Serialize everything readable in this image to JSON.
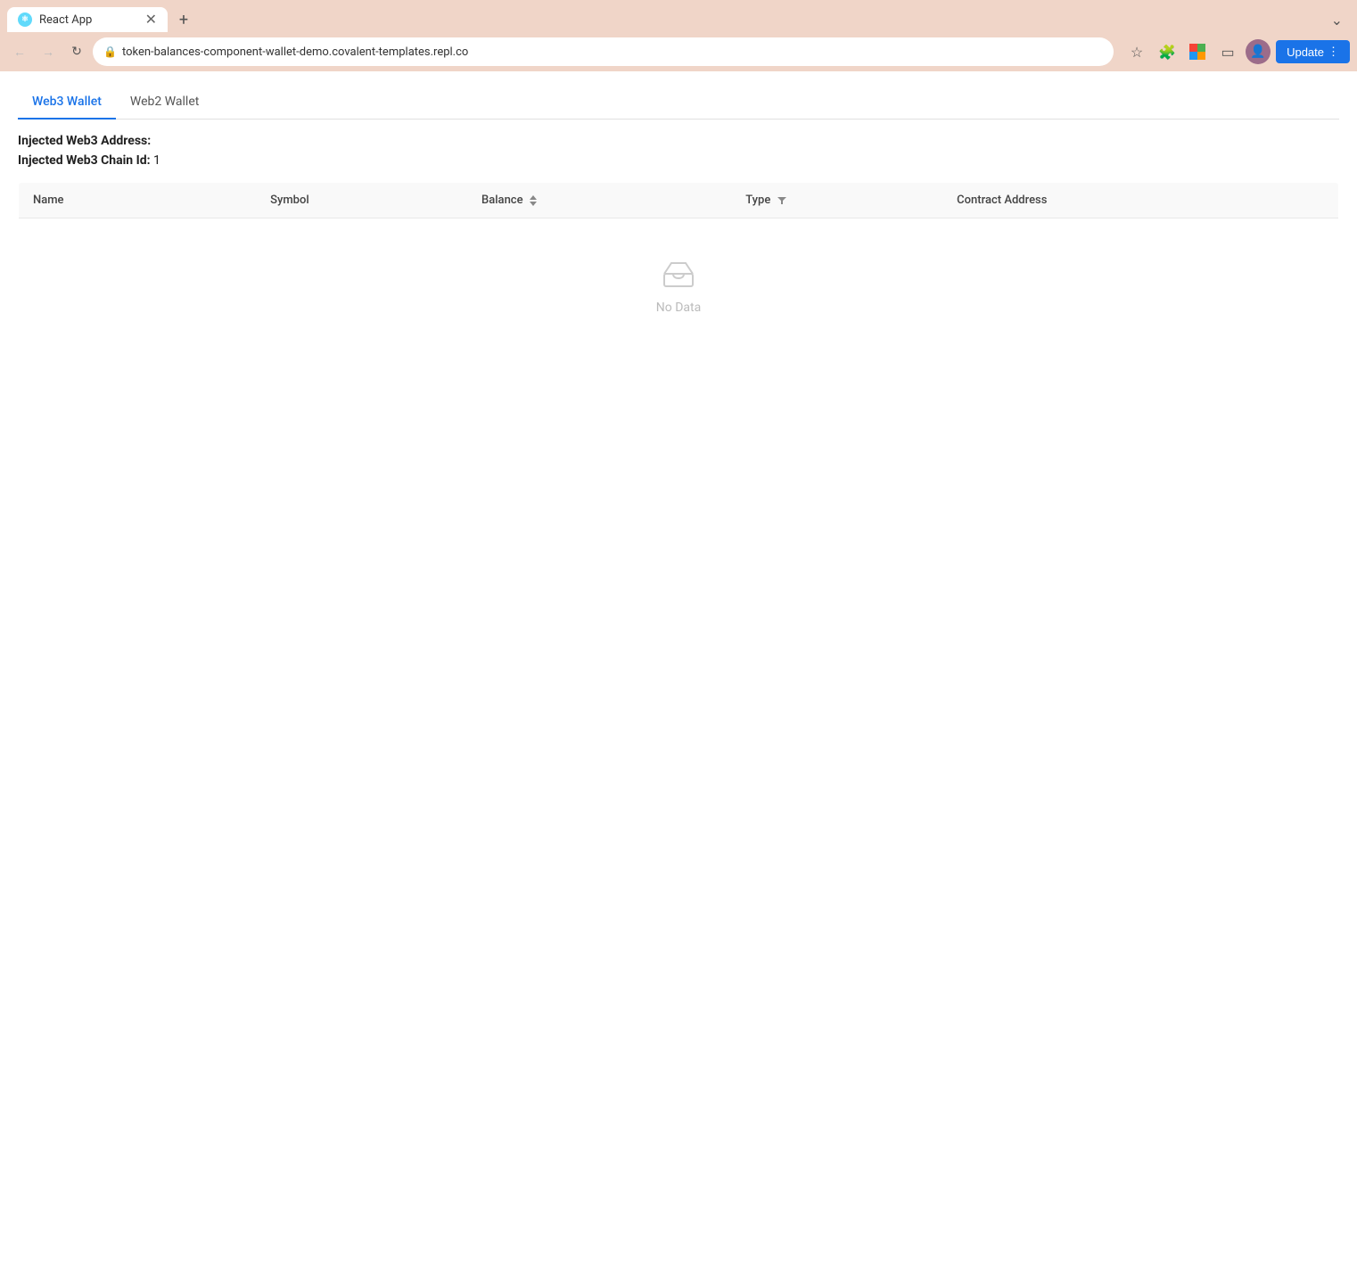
{
  "browser": {
    "tab_title": "React App",
    "tab_favicon": "R",
    "address": "token-balances-component-wallet-demo.covalent-templates.repl.co",
    "update_button": "Update"
  },
  "app_tabs": [
    {
      "label": "Web3 Wallet",
      "active": true
    },
    {
      "label": "Web2 Wallet",
      "active": false
    }
  ],
  "wallet_info": {
    "address_label": "Injected Web3 Address:",
    "address_value": "",
    "chain_label": "Injected Web3 Chain Id:",
    "chain_value": "1"
  },
  "table": {
    "columns": [
      {
        "key": "name",
        "label": "Name",
        "sortable": false,
        "filterable": false
      },
      {
        "key": "symbol",
        "label": "Symbol",
        "sortable": false,
        "filterable": false
      },
      {
        "key": "balance",
        "label": "Balance",
        "sortable": true,
        "filterable": false
      },
      {
        "key": "type",
        "label": "Type",
        "sortable": false,
        "filterable": true
      },
      {
        "key": "contract",
        "label": "Contract Address",
        "sortable": false,
        "filterable": false
      }
    ],
    "rows": [],
    "empty_text": "No Data"
  }
}
